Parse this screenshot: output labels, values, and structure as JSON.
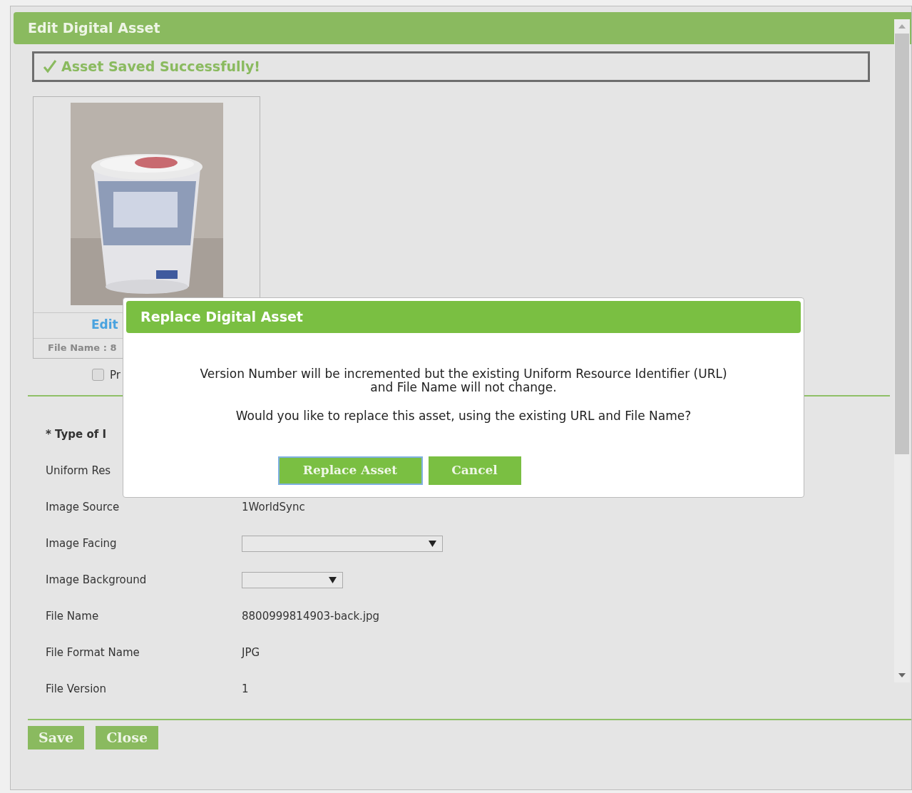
{
  "window": {
    "title": "Edit Digital Asset"
  },
  "alert": {
    "text": "Asset Saved Successfully!"
  },
  "asset_card": {
    "edit_link": "Edit",
    "file_name": "File Name : 8"
  },
  "checkbox": {
    "label": "Pr",
    "checked": false
  },
  "fields": [
    {
      "label": "* Type of I",
      "kind": "text",
      "required": true
    },
    {
      "label": "Uniform Res",
      "kind": "text"
    },
    {
      "label": "Image Source",
      "kind": "text",
      "value": "1WorldSync"
    },
    {
      "label": "Image Facing",
      "kind": "select-wide"
    },
    {
      "label": "Image Background",
      "kind": "select-narrow"
    },
    {
      "label": "File Name",
      "kind": "text",
      "value": "8800999814903-back.jpg"
    },
    {
      "label": "File Format Name",
      "kind": "text",
      "value": "JPG"
    },
    {
      "label": "File Version",
      "kind": "text",
      "value": "1"
    }
  ],
  "buttons": [
    {
      "label": "Save"
    },
    {
      "label": "Close"
    }
  ],
  "modal": {
    "title": "Replace Digital Asset",
    "message": "Version Number will be incremented but the existing Uniform Resource Identifier (URL) and File Name will not change.",
    "question": "Would you like to replace this asset, using the existing URL and File Name?",
    "buttons": [
      {
        "label": "Replace Asset",
        "focused": true
      },
      {
        "label": "Cancel",
        "focused": false
      }
    ]
  }
}
